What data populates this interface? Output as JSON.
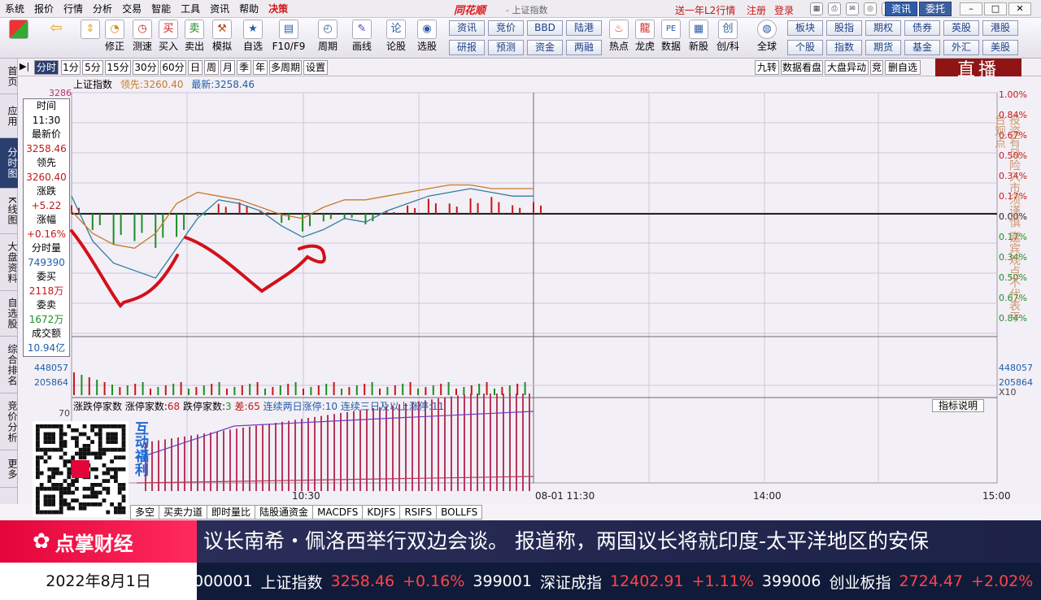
{
  "menubar": {
    "items": [
      "系统",
      "报价",
      "行情",
      "分析",
      "交易",
      "智能",
      "工具",
      "资讯",
      "帮助",
      "决策"
    ],
    "brand": "同花顺",
    "brand_sub": "- 上证指数",
    "promo": "送一年L2行情",
    "login_links": [
      "注册",
      "登录"
    ],
    "btn_zixun": "资讯",
    "btn_weituo": "委托"
  },
  "toolbar": {
    "tools": [
      "修正",
      "测速",
      "买入",
      "卖出",
      "模拟",
      "自选",
      "F10/F9",
      "周期",
      "画线",
      "论股",
      "选股"
    ],
    "grid_buttons": [
      [
        "资讯",
        "竞价",
        "BBD",
        "陆港"
      ],
      [
        "研报",
        "预测",
        "资金",
        "两融"
      ]
    ],
    "icons2": [
      "热点",
      "龙虎",
      "数据",
      "新股",
      "创/科",
      "全球"
    ],
    "grid2": [
      [
        "板块",
        "股指",
        "期权",
        "债券",
        "英股",
        "港股"
      ],
      [
        "个股",
        "指数",
        "期货",
        "基金",
        "外汇",
        "美股"
      ]
    ]
  },
  "leftnav": [
    "首页",
    "应用",
    "分时图",
    "K线图",
    "大盘资料",
    "自选股",
    "综合排名",
    "竞价分析",
    "更多"
  ],
  "periods": [
    "分时",
    "1分",
    "5分",
    "15分",
    "30分",
    "60分",
    "日",
    "周",
    "月",
    "季",
    "年",
    "多周期",
    "设置"
  ],
  "right_tabs": [
    "九转",
    "数据看盘",
    "大盘异动",
    "竞",
    "删自选"
  ],
  "live_label": "直播",
  "header": {
    "name": "上证指数",
    "lead_label": "领先:",
    "lead_value": "3260.40",
    "latest_label": "最新:",
    "latest_value": "3258.46"
  },
  "quote": {
    "time_label": "时间",
    "time": "11:30",
    "latest_label": "最新价",
    "latest": "3258.46",
    "lead_label": "领先",
    "lead": "3260.40",
    "chg_label": "涨跌",
    "chg": "+5.22",
    "pct_label": "涨幅",
    "pct": "+0.16%",
    "vol_label": "分时量",
    "vol": "749390",
    "buy_label": "委买",
    "buy": "2118万",
    "sell_label": "委卖",
    "sell": "1672万",
    "amt_label": "成交额",
    "amt": "10.94亿"
  },
  "axes": {
    "left_top": "3286",
    "right_pcts": [
      "1.00%",
      "0.84%",
      "0.67%",
      "0.50%",
      "0.34%",
      "0.17%",
      "0.00%",
      "0.17%",
      "0.34%",
      "0.50%",
      "0.67%",
      "0.84%"
    ],
    "vol_ticks": [
      "448057",
      "205864"
    ],
    "x_ticks": [
      "10:30",
      "08-01 11:30",
      "14:00",
      "15:00"
    ],
    "small_left": "70",
    "small_right": "X10"
  },
  "board": {
    "text1": "涨跌停家数",
    "text2": "涨停家数:",
    "zt": "68",
    "text3": "跌停家数:",
    "dt": "3",
    "text4": "差:",
    "diff": "65",
    "text5": "连续两日涨停:",
    "two": "10",
    "text6": "连续三日及以上涨停:",
    "three": "11"
  },
  "indicator_btn": "指标说明",
  "bottom_tabs": [
    "多空",
    "买卖力道",
    "即时量比",
    "陆股通资金",
    "MACDFS",
    "KDJFS",
    "RSIFS",
    "BOLLFS"
  ],
  "disclaimer": "投资有风险入市须谨慎 嘉宾观点不代表平台观点",
  "qr_label": "互动福利",
  "banner": {
    "brand": "点掌财经",
    "news": "议长南希・佩洛西举行双边会谈。 报道称，两国议长将就印度-太平洋地区的安保",
    "date": "2022年8月1日"
  },
  "ticker": [
    {
      "code": "000001",
      "name": "上证指数",
      "price": "3258.46",
      "chg": "+0.16%"
    },
    {
      "code": "399001",
      "name": "深证成指",
      "price": "12402.91",
      "chg": "+1.11%"
    },
    {
      "code": "399006",
      "name": "创业板指",
      "price": "2724.47",
      "chg": "+2.02%"
    }
  ],
  "chart_data": {
    "type": "line",
    "title": "上证指数",
    "ylabel": "",
    "xlabel": "",
    "x_ticks": [
      "10:30",
      "08-01 11:30",
      "14:00",
      "15:00"
    ],
    "y_right_pct_range": [
      -1.0,
      1.0
    ],
    "prev_close": 3253.24,
    "series": [
      {
        "name": "最新",
        "values": [
          3258,
          3246,
          3240,
          3238,
          3236,
          3244,
          3252,
          3257,
          3256,
          3254,
          3250,
          3247,
          3249,
          3252,
          3251,
          3254,
          3256,
          3258,
          3259,
          3260,
          3259,
          3258,
          3258
        ]
      },
      {
        "name": "领先",
        "values": [
          3254,
          3248,
          3245,
          3244,
          3248,
          3256,
          3259,
          3258,
          3257,
          3255,
          3253,
          3252,
          3255,
          3257,
          3257,
          3258,
          3259,
          3260,
          3261,
          3261,
          3260,
          3260,
          3260
        ]
      }
    ]
  }
}
